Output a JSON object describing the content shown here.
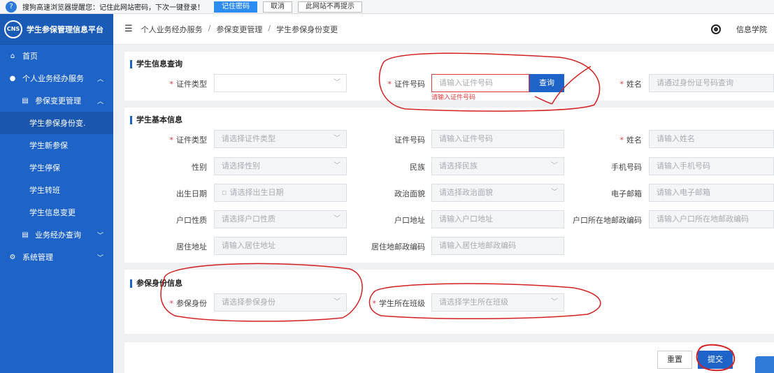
{
  "prompt_bar": {
    "icon": "question-icon",
    "message": "搜狗高速浏览器提醒您：记住此网站密码，下次一键登录！",
    "remember_label": "记住密码",
    "cancel_label": "取消",
    "never_label": "此网站不再提示"
  },
  "sidebar": {
    "logo_text": "CNS",
    "title": "学生参保管理信息平台",
    "items": [
      {
        "label": "首页",
        "icon": "home-icon"
      },
      {
        "label": "个人业务经办服务",
        "icon": "user-icon"
      },
      {
        "label": "参保变更管理",
        "icon": "clipboard-icon"
      },
      {
        "label": "学生参保身份变."
      },
      {
        "label": "学生新参保"
      },
      {
        "label": "学生停保"
      },
      {
        "label": "学生转班"
      },
      {
        "label": "学生信息变更"
      },
      {
        "label": "业务经办查询",
        "icon": "clipboard-icon"
      },
      {
        "label": "系统管理",
        "icon": "gear-icon"
      }
    ]
  },
  "header": {
    "breadcrumb": [
      "个人业务经办服务",
      "参保变更管理",
      "学生参保身份变更"
    ],
    "user_name": "信息学院"
  },
  "query_section": {
    "title": "学生信息查询",
    "id_type_label": "证件类型",
    "id_type_value": "",
    "id_number_label": "证件号码",
    "id_number_placeholder": "请输入证件号码",
    "id_number_error": "请输入证件号码",
    "query_button": "查询",
    "name_label": "姓名",
    "name_placeholder": "请通过身份证号码查询"
  },
  "basic_section": {
    "title": "学生基本信息",
    "fields": {
      "id_type": {
        "label": "证件类型",
        "placeholder": "请选择证件类型"
      },
      "id_number": {
        "label": "证件号码",
        "placeholder": "请输入证件号码"
      },
      "name": {
        "label": "姓名",
        "placeholder": "请输入姓名"
      },
      "gender": {
        "label": "性别",
        "placeholder": "请选择性别"
      },
      "ethnicity": {
        "label": "民族",
        "placeholder": "请选择民族"
      },
      "phone": {
        "label": "手机号码",
        "placeholder": "请输入手机号码"
      },
      "birth_date": {
        "label": "出生日期",
        "placeholder": "请选择出生日期"
      },
      "political": {
        "label": "政治面貌",
        "placeholder": "请选择政治面貌"
      },
      "email": {
        "label": "电子邮箱",
        "placeholder": "请输入电子邮箱"
      },
      "hukou_type": {
        "label": "户口性质",
        "placeholder": "请选择户口性质"
      },
      "hukou_address": {
        "label": "户口地址",
        "placeholder": "请输入户口地址"
      },
      "hukou_postcode": {
        "label": "户口所在地邮政编码",
        "placeholder": "请输入户口所在地邮政编码"
      },
      "residence_address": {
        "label": "居住地址",
        "placeholder": "请输入居住地址"
      },
      "residence_postcode": {
        "label": "居住地邮政编码",
        "placeholder": "请输入居住地邮政编码"
      }
    }
  },
  "insurance_section": {
    "title": "参保身份信息",
    "identity_label": "参保身份",
    "identity_placeholder": "请选择参保身份",
    "class_label": "学生所在班级",
    "class_placeholder": "请选择学生所在班级"
  },
  "actions": {
    "reset_label": "重置",
    "submit_label": "提交"
  },
  "colors": {
    "sidebar": "#1e64c8",
    "primary": "#1e64c8",
    "required": "#e03b3b",
    "annotation": "#d42020"
  }
}
